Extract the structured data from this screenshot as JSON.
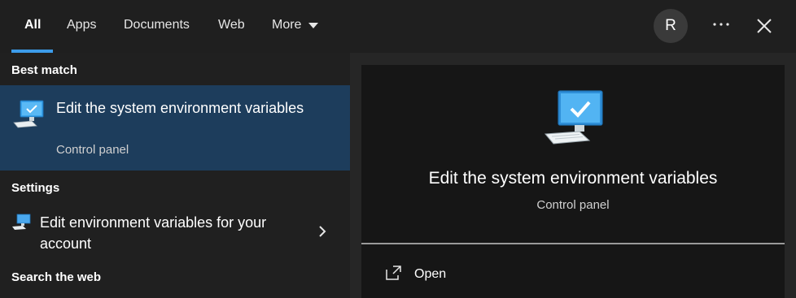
{
  "tabs": [
    {
      "label": "All",
      "active": true
    },
    {
      "label": "Apps"
    },
    {
      "label": "Documents"
    },
    {
      "label": "Web"
    },
    {
      "label": "More"
    }
  ],
  "account": {
    "initial": "R"
  },
  "sections": {
    "best_match": "Best match",
    "settings": "Settings",
    "search_web": "Search the web"
  },
  "best_match": {
    "title": "Edit the system environment variables",
    "subtitle": "Control panel",
    "icon": "computer-monitor-check-icon"
  },
  "setting_item": {
    "title": "Edit environment variables for your account",
    "icon": "computer-monitor-icon"
  },
  "detail": {
    "title": "Edit the system environment variables",
    "subtitle": "Control panel",
    "actions": [
      {
        "label": "Open",
        "icon": "open-external-icon"
      }
    ]
  },
  "colors": {
    "accent": "#3c9cea",
    "selected_bg": "#1d3d5c",
    "background": "#1f1f1f"
  }
}
